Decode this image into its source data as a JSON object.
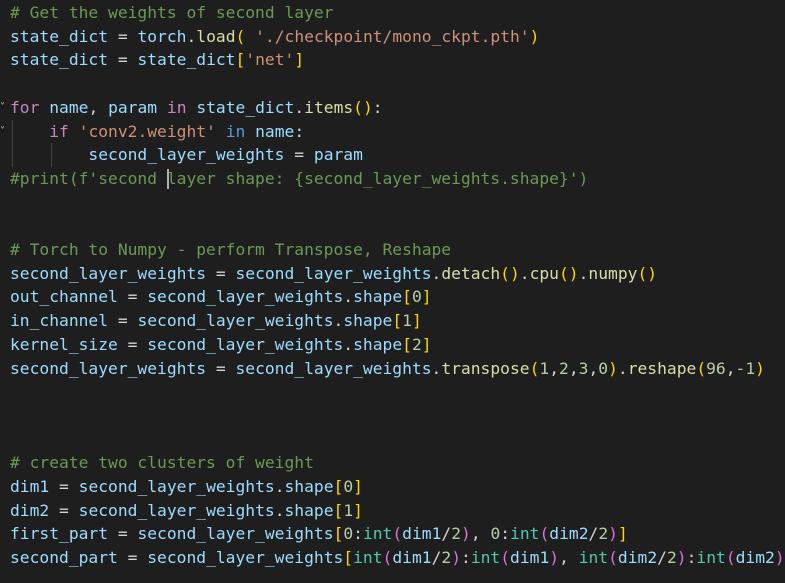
{
  "lines": [
    [
      {
        "t": "# Get the weights of second layer",
        "c": "t-com"
      }
    ],
    [
      {
        "t": "state_dict",
        "c": "t-var"
      },
      {
        "t": " = ",
        "c": "t-op"
      },
      {
        "t": "torch",
        "c": "t-var"
      },
      {
        "t": ".",
        "c": "t-op"
      },
      {
        "t": "load",
        "c": "t-fn"
      },
      {
        "t": "(",
        "c": "br1"
      },
      {
        "t": " ",
        "c": "t-op"
      },
      {
        "t": "'./checkpoint/mono_ckpt.pth'",
        "c": "t-str"
      },
      {
        "t": ")",
        "c": "br1"
      }
    ],
    [
      {
        "t": "state_dict",
        "c": "t-var"
      },
      {
        "t": " = ",
        "c": "t-op"
      },
      {
        "t": "state_dict",
        "c": "t-var"
      },
      {
        "t": "[",
        "c": "br1"
      },
      {
        "t": "'net'",
        "c": "t-str"
      },
      {
        "t": "]",
        "c": "br1"
      }
    ],
    [],
    [
      {
        "t": "for",
        "c": "t-kw"
      },
      {
        "t": " ",
        "c": "t-op"
      },
      {
        "t": "name",
        "c": "t-var"
      },
      {
        "t": ", ",
        "c": "t-op"
      },
      {
        "t": "param",
        "c": "t-var"
      },
      {
        "t": " ",
        "c": "t-op"
      },
      {
        "t": "in",
        "c": "t-kw"
      },
      {
        "t": " ",
        "c": "t-op"
      },
      {
        "t": "state_dict",
        "c": "t-var"
      },
      {
        "t": ".",
        "c": "t-op"
      },
      {
        "t": "items",
        "c": "t-fn"
      },
      {
        "t": "()",
        "c": "br1"
      },
      {
        "t": ":",
        "c": "t-op"
      }
    ],
    [
      {
        "t": "    ",
        "c": "t-op"
      },
      {
        "t": "if",
        "c": "t-kw"
      },
      {
        "t": " ",
        "c": "t-op"
      },
      {
        "t": "'conv2.weight'",
        "c": "t-str"
      },
      {
        "t": " ",
        "c": "t-op"
      },
      {
        "t": "in",
        "c": "t-in"
      },
      {
        "t": " ",
        "c": "t-op"
      },
      {
        "t": "name",
        "c": "t-var"
      },
      {
        "t": ":",
        "c": "t-op"
      }
    ],
    [
      {
        "t": "        ",
        "c": "t-op"
      },
      {
        "t": "second_layer_weights",
        "c": "t-var"
      },
      {
        "t": " = ",
        "c": "t-op"
      },
      {
        "t": "param",
        "c": "t-var"
      }
    ],
    [
      {
        "t": "#print(f'second layer shape: {second_layer_weights.shape}')",
        "c": "t-com"
      }
    ],
    [],
    [],
    [
      {
        "t": "# Torch to Numpy - perform Transpose, Reshape",
        "c": "t-com"
      }
    ],
    [
      {
        "t": "second_layer_weights",
        "c": "t-var"
      },
      {
        "t": " = ",
        "c": "t-op"
      },
      {
        "t": "second_layer_weights",
        "c": "t-var"
      },
      {
        "t": ".",
        "c": "t-op"
      },
      {
        "t": "detach",
        "c": "t-fn"
      },
      {
        "t": "()",
        "c": "br1"
      },
      {
        "t": ".",
        "c": "t-op"
      },
      {
        "t": "cpu",
        "c": "t-fn"
      },
      {
        "t": "()",
        "c": "br1"
      },
      {
        "t": ".",
        "c": "t-op"
      },
      {
        "t": "numpy",
        "c": "t-fn"
      },
      {
        "t": "()",
        "c": "br1"
      }
    ],
    [
      {
        "t": "out_channel",
        "c": "t-var"
      },
      {
        "t": " = ",
        "c": "t-op"
      },
      {
        "t": "second_layer_weights",
        "c": "t-var"
      },
      {
        "t": ".",
        "c": "t-op"
      },
      {
        "t": "shape",
        "c": "t-var"
      },
      {
        "t": "[",
        "c": "br1"
      },
      {
        "t": "0",
        "c": "t-num"
      },
      {
        "t": "]",
        "c": "br1"
      }
    ],
    [
      {
        "t": "in_channel",
        "c": "t-var"
      },
      {
        "t": " = ",
        "c": "t-op"
      },
      {
        "t": "second_layer_weights",
        "c": "t-var"
      },
      {
        "t": ".",
        "c": "t-op"
      },
      {
        "t": "shape",
        "c": "t-var"
      },
      {
        "t": "[",
        "c": "br1"
      },
      {
        "t": "1",
        "c": "t-num"
      },
      {
        "t": "]",
        "c": "br1"
      }
    ],
    [
      {
        "t": "kernel_size",
        "c": "t-var"
      },
      {
        "t": " = ",
        "c": "t-op"
      },
      {
        "t": "second_layer_weights",
        "c": "t-var"
      },
      {
        "t": ".",
        "c": "t-op"
      },
      {
        "t": "shape",
        "c": "t-var"
      },
      {
        "t": "[",
        "c": "br1"
      },
      {
        "t": "2",
        "c": "t-num"
      },
      {
        "t": "]",
        "c": "br1"
      }
    ],
    [
      {
        "t": "second_layer_weights",
        "c": "t-var"
      },
      {
        "t": " = ",
        "c": "t-op"
      },
      {
        "t": "second_layer_weights",
        "c": "t-var"
      },
      {
        "t": ".",
        "c": "t-op"
      },
      {
        "t": "transpose",
        "c": "t-fn"
      },
      {
        "t": "(",
        "c": "br1"
      },
      {
        "t": "1",
        "c": "t-num"
      },
      {
        "t": ",",
        "c": "t-op"
      },
      {
        "t": "2",
        "c": "t-num"
      },
      {
        "t": ",",
        "c": "t-op"
      },
      {
        "t": "3",
        "c": "t-num"
      },
      {
        "t": ",",
        "c": "t-op"
      },
      {
        "t": "0",
        "c": "t-num"
      },
      {
        "t": ")",
        "c": "br1"
      },
      {
        "t": ".",
        "c": "t-op"
      },
      {
        "t": "reshape",
        "c": "t-fn"
      },
      {
        "t": "(",
        "c": "br1"
      },
      {
        "t": "96",
        "c": "t-num"
      },
      {
        "t": ",",
        "c": "t-op"
      },
      {
        "t": "-1",
        "c": "t-num"
      },
      {
        "t": ")",
        "c": "br1"
      }
    ],
    [],
    [],
    [],
    [
      {
        "t": "# create two clusters of weight",
        "c": "t-com"
      }
    ],
    [
      {
        "t": "dim1",
        "c": "t-var"
      },
      {
        "t": " = ",
        "c": "t-op"
      },
      {
        "t": "second_layer_weights",
        "c": "t-var"
      },
      {
        "t": ".",
        "c": "t-op"
      },
      {
        "t": "shape",
        "c": "t-var"
      },
      {
        "t": "[",
        "c": "br1"
      },
      {
        "t": "0",
        "c": "t-num"
      },
      {
        "t": "]",
        "c": "br1"
      }
    ],
    [
      {
        "t": "dim2",
        "c": "t-var"
      },
      {
        "t": " = ",
        "c": "t-op"
      },
      {
        "t": "second_layer_weights",
        "c": "t-var"
      },
      {
        "t": ".",
        "c": "t-op"
      },
      {
        "t": "shape",
        "c": "t-var"
      },
      {
        "t": "[",
        "c": "br1"
      },
      {
        "t": "1",
        "c": "t-num"
      },
      {
        "t": "]",
        "c": "br1"
      }
    ],
    [
      {
        "t": "first_part",
        "c": "t-var"
      },
      {
        "t": " = ",
        "c": "t-op"
      },
      {
        "t": "second_layer_weights",
        "c": "t-var"
      },
      {
        "t": "[",
        "c": "br1"
      },
      {
        "t": "0",
        "c": "t-num"
      },
      {
        "t": ":",
        "c": "t-op"
      },
      {
        "t": "int",
        "c": "t-cls"
      },
      {
        "t": "(",
        "c": "br2"
      },
      {
        "t": "dim1",
        "c": "t-var"
      },
      {
        "t": "/",
        "c": "t-op"
      },
      {
        "t": "2",
        "c": "t-num"
      },
      {
        "t": ")",
        "c": "br2"
      },
      {
        "t": ", ",
        "c": "t-op"
      },
      {
        "t": "0",
        "c": "t-num"
      },
      {
        "t": ":",
        "c": "t-op"
      },
      {
        "t": "int",
        "c": "t-cls"
      },
      {
        "t": "(",
        "c": "br2"
      },
      {
        "t": "dim2",
        "c": "t-var"
      },
      {
        "t": "/",
        "c": "t-op"
      },
      {
        "t": "2",
        "c": "t-num"
      },
      {
        "t": ")",
        "c": "br2"
      },
      {
        "t": "]",
        "c": "br1"
      }
    ],
    [
      {
        "t": "second_part",
        "c": "t-var"
      },
      {
        "t": " = ",
        "c": "t-op"
      },
      {
        "t": "second_layer_weights",
        "c": "t-var"
      },
      {
        "t": "[",
        "c": "br1"
      },
      {
        "t": "int",
        "c": "t-cls"
      },
      {
        "t": "(",
        "c": "br2"
      },
      {
        "t": "dim1",
        "c": "t-var"
      },
      {
        "t": "/",
        "c": "t-op"
      },
      {
        "t": "2",
        "c": "t-num"
      },
      {
        "t": ")",
        "c": "br2"
      },
      {
        "t": ":",
        "c": "t-op"
      },
      {
        "t": "int",
        "c": "t-cls"
      },
      {
        "t": "(",
        "c": "br2"
      },
      {
        "t": "dim1",
        "c": "t-var"
      },
      {
        "t": ")",
        "c": "br2"
      },
      {
        "t": ", ",
        "c": "t-op"
      },
      {
        "t": "int",
        "c": "t-cls"
      },
      {
        "t": "(",
        "c": "br2"
      },
      {
        "t": "dim2",
        "c": "t-var"
      },
      {
        "t": "/",
        "c": "t-op"
      },
      {
        "t": "2",
        "c": "t-num"
      },
      {
        "t": ")",
        "c": "br2"
      },
      {
        "t": ":",
        "c": "t-op"
      },
      {
        "t": "int",
        "c": "t-cls"
      },
      {
        "t": "(",
        "c": "br2"
      },
      {
        "t": "dim2",
        "c": "t-var"
      },
      {
        "t": ")",
        "c": "br2"
      },
      {
        "t": "]",
        "c": "br1"
      }
    ]
  ],
  "fold_markers": [
    {
      "line": 4,
      "icon": "chevron-down-icon"
    },
    {
      "line": 5,
      "icon": "chevron-down-icon"
    }
  ],
  "colors": {
    "background": "#1e1e1e",
    "comment": "#6a9955",
    "variable": "#9cdcfe",
    "function": "#dcdcaa",
    "string": "#ce9178",
    "keyword": "#c586c0",
    "number": "#b5cea8",
    "builtin": "#4ec9b0",
    "bracket_level1": "#ffd700",
    "bracket_level2": "#da70d6"
  }
}
